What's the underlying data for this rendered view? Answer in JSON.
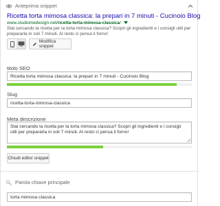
{
  "snippet_preview": {
    "header": "Anteprima snippet",
    "title": "Ricetta torta mimosa classica: la prepari in 7 minuti - Cucinoio Blog",
    "url_prefix": "www.studiomedesign.net/",
    "url_slug": "ricetta-torta-mimosa-classica",
    "url_suffix": "/",
    "description": "Stai cercando la ricetta per la torta mimosa classica? Scopri gli ingredienti e i consigli utili per prepararla in soli 7 minuti. Al resto ci pensa il forno!",
    "edit_button_label": "Modifica snippet",
    "devices": [
      "mobile",
      "desktop"
    ],
    "active_device": "desktop"
  },
  "seo_title": {
    "label": "titolo SEO",
    "value": "Ricetta torta mimosa classica: la prepari in 7 minuti - Cucinoio Blog",
    "progress_fraction": 0.92,
    "progress_color": "#7ad03a"
  },
  "slug": {
    "label": "Slug",
    "value": "ricetta-torta-mimosa-classica"
  },
  "meta_description": {
    "label": "Meta descrizione",
    "value": "Stai cercando la ricetta per la torta mimosa classica? Scopri gli ingredienti e i consigli utili per prepararla in soli 7 minuti. Al resto ci pensa il forno!",
    "progress_fraction": 0.52,
    "progress_color": "#7ad03a"
  },
  "close_editor_label": "Chiudi editor snippet",
  "focus_keyword": {
    "header": "Parola chiave principale",
    "value": "torta mimosa classica"
  },
  "colors": {
    "link_title": "#1a0dab",
    "url_green": "#006621",
    "progress_ok": "#7ad03a"
  }
}
